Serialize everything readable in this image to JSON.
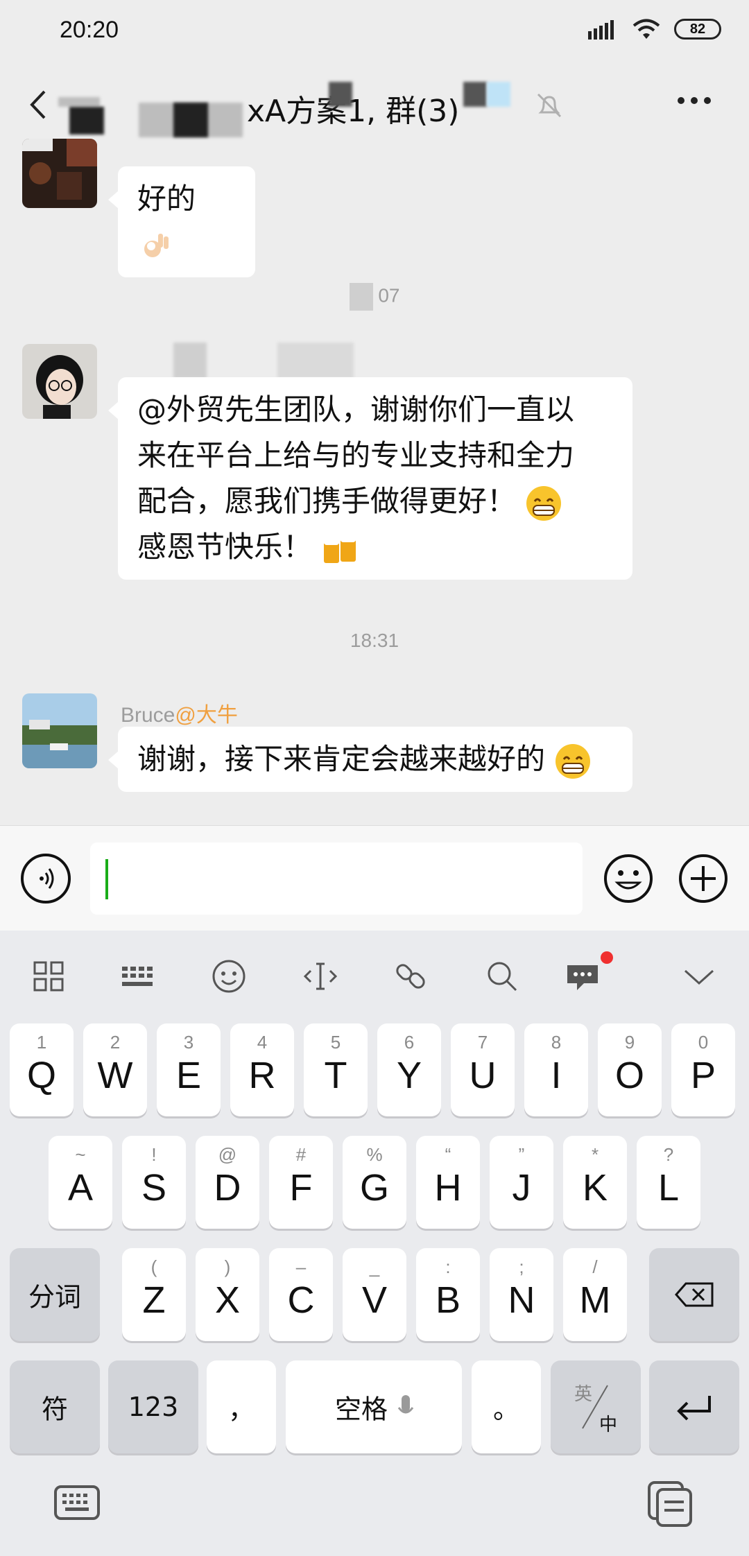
{
  "status_bar": {
    "time": "20:20",
    "battery": "82"
  },
  "title_bar": {
    "title": "xA方案1, 群(3)"
  },
  "messages": [
    {
      "type": "text",
      "text": "好的"
    },
    {
      "type": "timestamp",
      "text": "07"
    },
    {
      "type": "text",
      "lines": [
        "@外贸先生团队，谢谢你们一直以",
        "来在平台上给与的专业支持和全力",
        "配合，愿我们携手做得更好！",
        "感恩节快乐！"
      ]
    },
    {
      "type": "timestamp",
      "text": "18:31"
    },
    {
      "type": "text",
      "sender_name": "Bruce",
      "sender_mention": "@大牛",
      "text": "谢谢，接下来肯定会越来越好的"
    }
  ],
  "keyboard": {
    "row1": [
      {
        "sub": "1",
        "main": "Q"
      },
      {
        "sub": "2",
        "main": "W"
      },
      {
        "sub": "3",
        "main": "E"
      },
      {
        "sub": "4",
        "main": "R"
      },
      {
        "sub": "5",
        "main": "T"
      },
      {
        "sub": "6",
        "main": "Y"
      },
      {
        "sub": "7",
        "main": "U"
      },
      {
        "sub": "8",
        "main": "I"
      },
      {
        "sub": "9",
        "main": "O"
      },
      {
        "sub": "0",
        "main": "P"
      }
    ],
    "row2": [
      {
        "sub": "~",
        "main": "A"
      },
      {
        "sub": "!",
        "main": "S"
      },
      {
        "sub": "@",
        "main": "D"
      },
      {
        "sub": "#",
        "main": "F"
      },
      {
        "sub": "%",
        "main": "G"
      },
      {
        "sub": "“",
        "main": "H"
      },
      {
        "sub": "”",
        "main": "J"
      },
      {
        "sub": "*",
        "main": "K"
      },
      {
        "sub": "?",
        "main": "L"
      }
    ],
    "row3": [
      {
        "sub": "(",
        "main": "Z"
      },
      {
        "sub": ")",
        "main": "X"
      },
      {
        "sub": "–",
        "main": "C"
      },
      {
        "sub": "_",
        "main": "V"
      },
      {
        "sub": ":",
        "main": "B"
      },
      {
        "sub": ";",
        "main": "N"
      },
      {
        "sub": "/",
        "main": "M"
      }
    ],
    "segment_label": "分词",
    "symbol_label": "符",
    "numbers_label": "123",
    "comma_label": "，",
    "space_label": "空格",
    "period_label": "。",
    "lang_top": "英",
    "lang_bottom": "中"
  }
}
